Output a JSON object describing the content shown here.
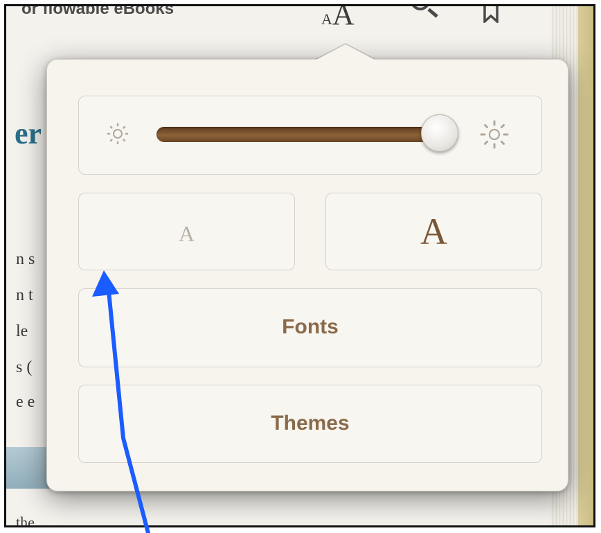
{
  "toolbar": {
    "header_text": "or flowable eBooks",
    "font_size_small": "A",
    "font_size_large": "A"
  },
  "background_page": {
    "heading_fragment": "er",
    "line_fragments": [
      "n s",
      "n t",
      "le",
      "s (",
      "e e"
    ],
    "bottom_fragment": "the"
  },
  "popover": {
    "brightness": {
      "level": 0.92
    },
    "small_font_label": "A",
    "large_font_label": "A",
    "fonts_label": "Fonts",
    "themes_label": "Themes"
  },
  "colors": {
    "accent_brown": "#8a6a4a",
    "slider_fill": "#7a5232",
    "annotation_arrow": "#1a5cff"
  }
}
